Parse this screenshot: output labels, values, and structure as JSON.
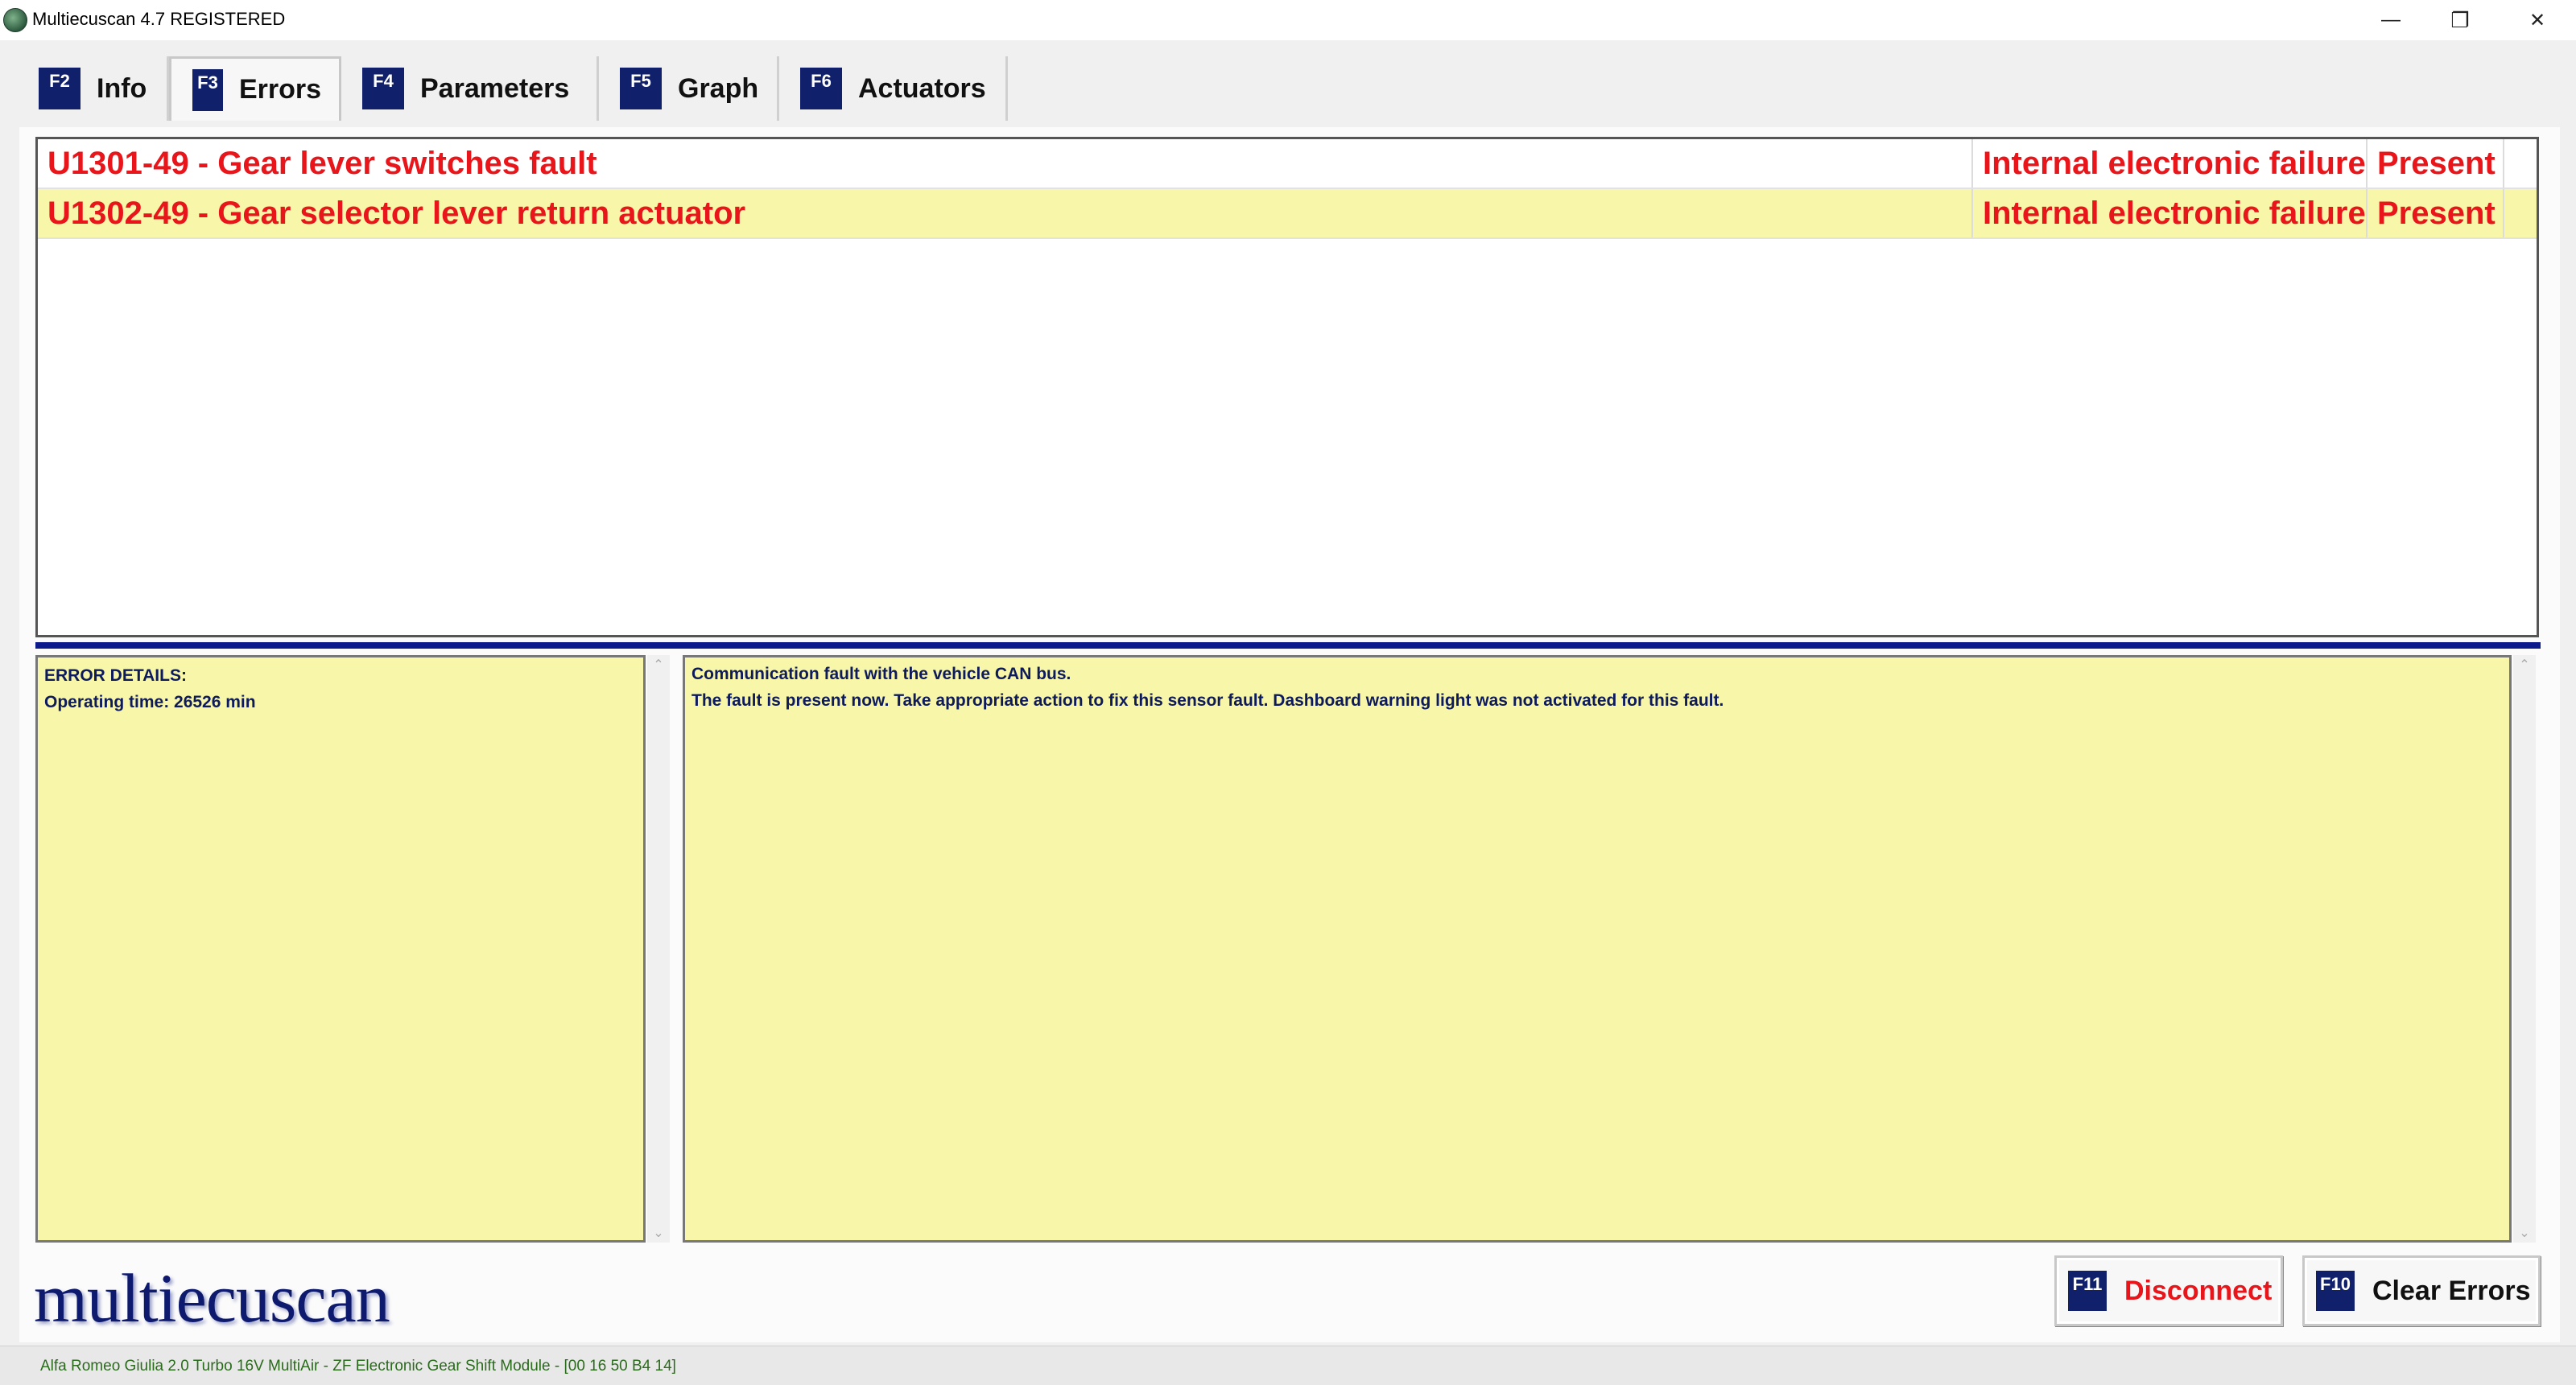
{
  "window": {
    "title": "Multiecuscan 4.7 REGISTERED",
    "minimize_glyph": "—",
    "restore_glyph": "❐",
    "close_glyph": "✕"
  },
  "tabs": [
    {
      "key": "F2",
      "label": "Info"
    },
    {
      "key": "F3",
      "label": "Errors"
    },
    {
      "key": "F4",
      "label": "Parameters"
    },
    {
      "key": "F5",
      "label": "Graph"
    },
    {
      "key": "F6",
      "label": "Actuators"
    }
  ],
  "errors": [
    {
      "code": "U1301-49 - Gear lever switches fault",
      "description": "Internal electronic failure",
      "status": "Present"
    },
    {
      "code": "U1302-49 - Gear selector lever return actuator",
      "description": "Internal electronic failure",
      "status": "Present"
    }
  ],
  "details": {
    "left_title": "ERROR DETAILS:",
    "left_line": "Operating time: 26526 min",
    "right_line1": "Communication fault with the vehicle CAN bus.",
    "right_line2": "The fault is present now. Take appropriate action to fix this sensor fault. Dashboard warning light was not activated for this fault."
  },
  "logo_text": "multiecuscan",
  "buttons": {
    "disconnect_key": "F11",
    "disconnect_label": "Disconnect",
    "clear_key": "F10",
    "clear_label": "Clear Errors"
  },
  "status_bar": "Alfa Romeo Giulia 2.0 Turbo 16V MultiAir - ZF Electronic Gear Shift Module - [00 16 50 B4 14]",
  "colors": {
    "error_text": "#e8151a",
    "row_highlight": "#f8f6a8",
    "fkey_bg": "#10206b",
    "divider": "#0d1a8c"
  }
}
